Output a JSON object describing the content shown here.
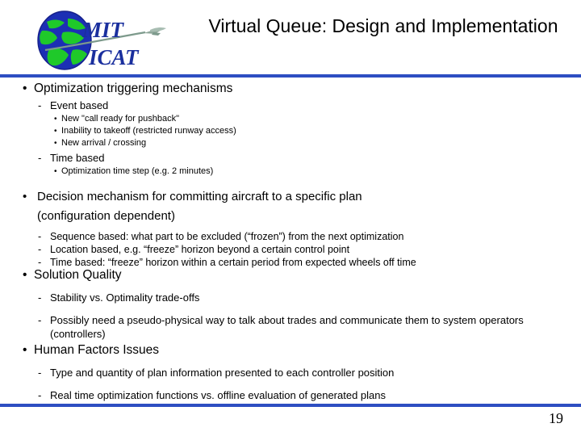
{
  "slide": {
    "title": "Virtual Queue: Design and Implementation",
    "page_number": "19",
    "accent_color": "#2e4ec2"
  },
  "logo": {
    "name": "mit-icat-logo",
    "line1": "MIT",
    "line2": "ICAT",
    "globe_ocean_color": "#1c2fb4",
    "globe_land_color": "#1fc92a",
    "text_color": "#1a2f9e",
    "plane_color": "#8fa79a"
  },
  "content": {
    "sections": [
      {
        "heading": "Optimization triggering mechanisms",
        "sub": [
          {
            "label": "Event based",
            "items": [
              "New \"call ready for pushback\"",
              "Inability to takeoff (restricted runway access)",
              "New arrival / crossing"
            ]
          },
          {
            "label": "Time based",
            "items": [
              "Optimization time step (e.g. 2 minutes)"
            ]
          }
        ]
      },
      {
        "heading_line1": "Decision mechanism for committing aircraft to a specific plan",
        "heading_line2": "(configuration dependent)",
        "dashes": [
          "Sequence based: what part to be excluded (“frozen”) from the next optimization",
          "Location based, e.g. “freeze” horizon beyond a certain control point",
          "Time based: “freeze” horizon within a certain period from expected wheels off time"
        ]
      },
      {
        "heading": "Solution Quality",
        "dashes": [
          "Stability vs. Optimality trade-offs",
          "Possibly need a pseudo-physical way to talk about trades and communicate them to system operators (controllers)"
        ]
      },
      {
        "heading": "Human Factors Issues",
        "dashes": [
          "Type and quantity of plan information presented to each controller position",
          "Real time optimization functions vs. offline evaluation of generated plans"
        ]
      }
    ]
  },
  "markers": {
    "bullet": "•",
    "dash": "-"
  }
}
